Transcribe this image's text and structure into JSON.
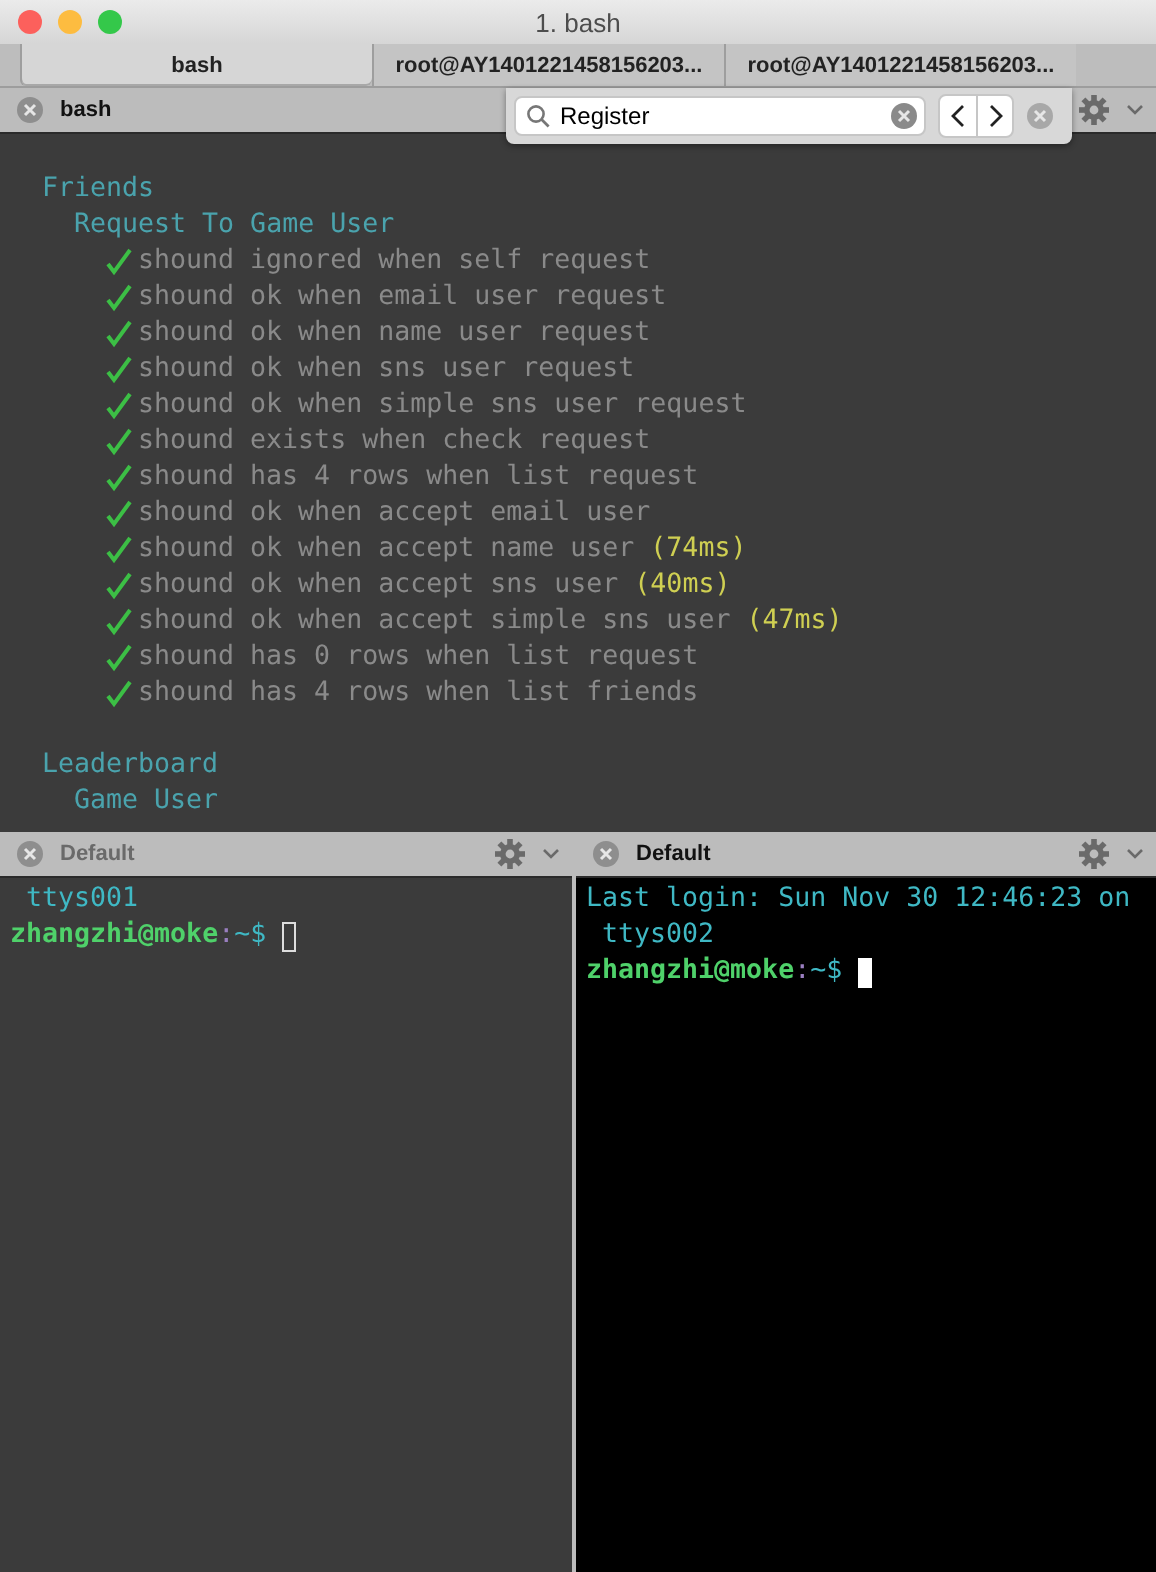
{
  "window": {
    "title": "1. bash"
  },
  "tabs": [
    {
      "label": "bash",
      "selected": true
    },
    {
      "label": "root@AY1401221458156203...",
      "selected": false
    },
    {
      "label": "root@AY1401221458156203...",
      "selected": false
    }
  ],
  "top_pane": {
    "title": "bash",
    "focused": true,
    "find_bar": {
      "value": "Register"
    },
    "suites": [
      {
        "title": "Friends",
        "children": [
          {
            "title": "Request To Game User",
            "tests": [
              {
                "name": "shound ignored when self request"
              },
              {
                "name": "shound ok when email user request"
              },
              {
                "name": "shound ok when name user request"
              },
              {
                "name": "shound ok when sns user request"
              },
              {
                "name": "shound ok when simple sns user request"
              },
              {
                "name": "shound exists when check request"
              },
              {
                "name": "shound has 4 rows when list request"
              },
              {
                "name": "shound ok when accept email user"
              },
              {
                "name": "shound ok when accept name user",
                "duration": "(74ms)"
              },
              {
                "name": "shound ok when accept sns user",
                "duration": "(40ms)"
              },
              {
                "name": "shound ok when accept simple sns user",
                "duration": "(47ms)"
              },
              {
                "name": "shound has 0 rows when list request"
              },
              {
                "name": "shound has 4 rows when list friends"
              }
            ]
          }
        ]
      },
      {
        "title": "Leaderboard",
        "children": [
          {
            "title": "Game User"
          }
        ]
      }
    ]
  },
  "bottom_panes": [
    {
      "title": "Default",
      "focused": false,
      "output": [
        "ttys001"
      ],
      "prompt": {
        "user": "zhangzhi@moke",
        "separator": ":",
        "path": "~$"
      }
    },
    {
      "title": "Default",
      "focused": true,
      "output": [
        "Last login: Sun Nov 30 12:46:23 on",
        "ttys002"
      ],
      "prompt": {
        "user": "zhangzhi@moke",
        "separator": ":",
        "path": "~$"
      }
    }
  ]
}
